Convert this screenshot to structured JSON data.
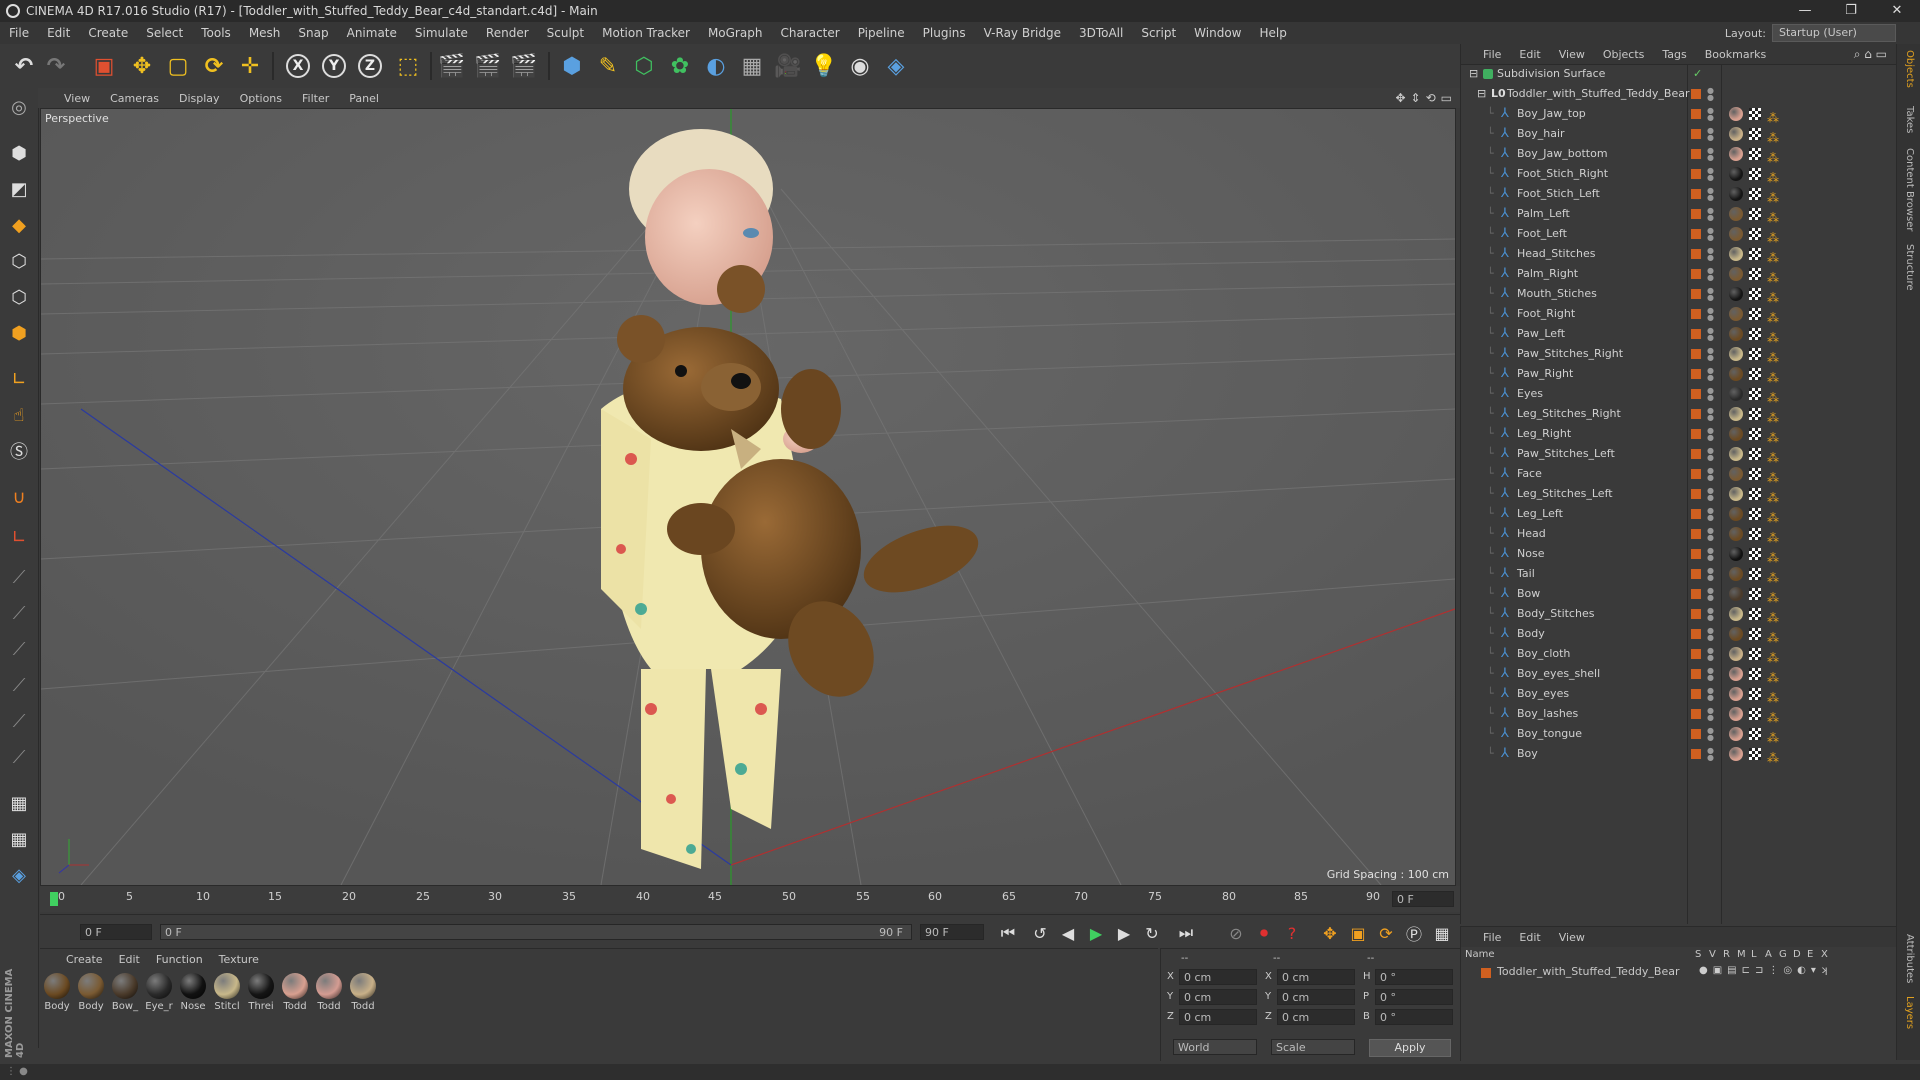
{
  "window": {
    "title": "CINEMA 4D R17.016 Studio (R17) - [Toddler_with_Stuffed_Teddy_Bear_c4d_standart.c4d] - Main",
    "controls": [
      "—",
      "❐",
      "✕"
    ]
  },
  "menu": [
    "File",
    "Edit",
    "Create",
    "Select",
    "Tools",
    "Mesh",
    "Snap",
    "Animate",
    "Simulate",
    "Render",
    "Sculpt",
    "Motion Tracker",
    "MoGraph",
    "Character",
    "Pipeline",
    "Plugins",
    "V-Ray Bridge",
    "3DToAll",
    "Script",
    "Window",
    "Help"
  ],
  "layout": {
    "label": "Layout:",
    "value": "Startup (User)"
  },
  "viewport": {
    "menu": [
      "View",
      "Cameras",
      "Display",
      "Options",
      "Filter",
      "Panel"
    ],
    "label": "Perspective",
    "grid_spacing": "Grid Spacing : 100 cm"
  },
  "timeline": {
    "ticks": [
      "0",
      "5",
      "10",
      "15",
      "20",
      "25",
      "30",
      "35",
      "40",
      "45",
      "50",
      "55",
      "60",
      "65",
      "70",
      "75",
      "80",
      "85",
      "90"
    ],
    "current_frame": "0 F",
    "start_field": "0 F",
    "range_start": "0 F",
    "range_end": "90 F",
    "end_field": "90 F"
  },
  "materials": {
    "menu": [
      "Create",
      "Edit",
      "Function",
      "Texture"
    ],
    "items": [
      {
        "label": "Body",
        "color": "#6b4a22"
      },
      {
        "label": "Body",
        "color": "#7a5a32"
      },
      {
        "label": "Bow_",
        "color": "#4a3a2a"
      },
      {
        "label": "Eye_r",
        "color": "#2a2a2a"
      },
      {
        "label": "Nose",
        "color": "#111111"
      },
      {
        "label": "Stitcl",
        "color": "#c8b88a"
      },
      {
        "label": "Threi",
        "color": "#151515"
      },
      {
        "label": "Todd",
        "color": "#d8a090"
      },
      {
        "label": "Todd",
        "color": "#d49c92"
      },
      {
        "label": "Todd",
        "color": "#c8b088"
      }
    ]
  },
  "coordinates": {
    "headers": [
      "--",
      "--",
      "--"
    ],
    "rows": [
      {
        "axis": "X",
        "pos": "0 cm",
        "axis2": "X",
        "size": "0 cm",
        "axis3": "H",
        "rot": "0 °"
      },
      {
        "axis": "Y",
        "pos": "0 cm",
        "axis2": "Y",
        "size": "0 cm",
        "axis3": "P",
        "rot": "0 °"
      },
      {
        "axis": "Z",
        "pos": "0 cm",
        "axis2": "Z",
        "size": "0 cm",
        "axis3": "B",
        "rot": "0 °"
      }
    ],
    "mode": "World",
    "mode2": "Scale",
    "apply": "Apply"
  },
  "objects": {
    "menu": [
      "File",
      "Edit",
      "View",
      "Objects",
      "Tags",
      "Bookmarks"
    ],
    "root": "Subdivision Surface",
    "group": "Toddler_with_Stuffed_Teddy_Bear",
    "items": [
      {
        "name": "Boy_Jaw_top",
        "mat": "#d8a090"
      },
      {
        "name": "Boy_hair",
        "mat": "#c8b088"
      },
      {
        "name": "Boy_Jaw_bottom",
        "mat": "#d8a090"
      },
      {
        "name": "Foot_Stich_Right",
        "mat": "#151515"
      },
      {
        "name": "Foot_Stich_Left",
        "mat": "#151515"
      },
      {
        "name": "Palm_Left",
        "mat": "#7a5a32"
      },
      {
        "name": "Foot_Left",
        "mat": "#7a5a32"
      },
      {
        "name": "Head_Stitches",
        "mat": "#c8b88a"
      },
      {
        "name": "Palm_Right",
        "mat": "#7a5a32"
      },
      {
        "name": "Mouth_Stiches",
        "mat": "#151515"
      },
      {
        "name": "Foot_Right",
        "mat": "#7a5a32"
      },
      {
        "name": "Paw_Left",
        "mat": "#6b4a22"
      },
      {
        "name": "Paw_Stitches_Right",
        "mat": "#c8b88a"
      },
      {
        "name": "Paw_Right",
        "mat": "#6b4a22"
      },
      {
        "name": "Eyes",
        "mat": "#2a2a2a"
      },
      {
        "name": "Leg_Stitches_Right",
        "mat": "#c8b88a"
      },
      {
        "name": "Leg_Right",
        "mat": "#6b4a22"
      },
      {
        "name": "Paw_Stitches_Left",
        "mat": "#c8b88a"
      },
      {
        "name": "Face",
        "mat": "#7a5a32"
      },
      {
        "name": "Leg_Stitches_Left",
        "mat": "#c8b88a"
      },
      {
        "name": "Leg_Left",
        "mat": "#6b4a22"
      },
      {
        "name": "Head",
        "mat": "#6b4a22"
      },
      {
        "name": "Nose",
        "mat": "#111111"
      },
      {
        "name": "Tail",
        "mat": "#6b4a22"
      },
      {
        "name": "Bow",
        "mat": "#4a3a2a"
      },
      {
        "name": "Body_Stitches",
        "mat": "#c8b88a"
      },
      {
        "name": "Body",
        "mat": "#6b4a22"
      },
      {
        "name": "Boy_cloth",
        "mat": "#c8b088"
      },
      {
        "name": "Boy_eyes_shell",
        "mat": "#d8a090"
      },
      {
        "name": "Boy_eyes",
        "mat": "#d8a090"
      },
      {
        "name": "Boy_lashes",
        "mat": "#d8a090"
      },
      {
        "name": "Boy_tongue",
        "mat": "#d8a090"
      },
      {
        "name": "Boy",
        "mat": "#d8a090"
      }
    ]
  },
  "layers": {
    "menu": [
      "File",
      "Edit",
      "View"
    ],
    "name_header": "Name",
    "columns": [
      "S",
      "V",
      "R",
      "M",
      "L",
      "A",
      "G",
      "D",
      "E",
      "X"
    ],
    "row": "Toddler_with_Stuffed_Teddy_Bear"
  },
  "right_tabs": [
    "Objects",
    "Takes",
    "Content Browser",
    "Structure",
    "Attributes",
    "Layers"
  ],
  "brand": "MAXON CINEMA 4D",
  "colors": {
    "accent": "#e0a020",
    "swatch": "#d06020",
    "object_icon": "#4a90d0"
  }
}
